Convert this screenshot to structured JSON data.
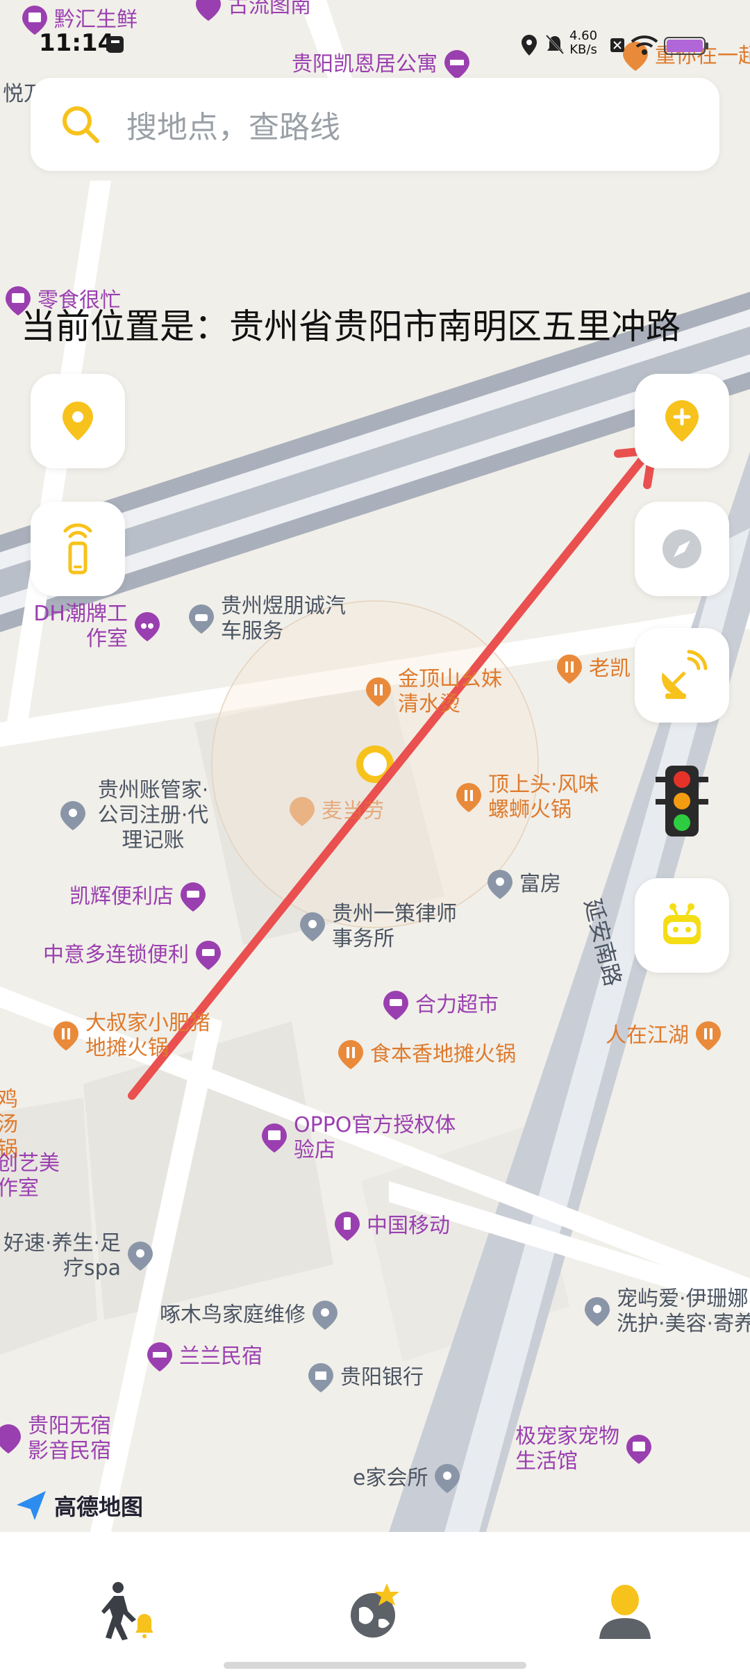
{
  "status_bar": {
    "time": "11:14",
    "net_speed": "4.60",
    "net_unit": "KB/s"
  },
  "search": {
    "placeholder": "搜地点，查路线"
  },
  "location": {
    "text": "当前位置是：贵州省贵阳市南明区五里冲路"
  },
  "brand": {
    "name": "高德地图"
  },
  "road_label": {
    "text": "延安南路"
  },
  "pois": [
    {
      "name": "黔汇生鲜",
      "color": "purple"
    },
    {
      "name": "古流图南",
      "color": "purple"
    },
    {
      "name": "贵阳凯恩居公寓",
      "color": "purple"
    },
    {
      "name": "重你在一起",
      "color": "orange"
    },
    {
      "name": "悦万",
      "color": "gray"
    },
    {
      "name": "零食很忙",
      "color": "purple"
    },
    {
      "name": "DH潮牌工作室",
      "color": "purple"
    },
    {
      "name": "贵州煜朋诚汽车服务",
      "color": "gray"
    },
    {
      "name": "金顶山幺妹清水烫",
      "color": "orange"
    },
    {
      "name": "老凯",
      "color": "orange"
    },
    {
      "name": "贵州账管家·公司注册·代理记账",
      "color": "gray"
    },
    {
      "name": "麦当劳",
      "color": "orange"
    },
    {
      "name": "顶上头·风味螺蛳火锅",
      "color": "orange"
    },
    {
      "name": "富房",
      "color": "gray"
    },
    {
      "name": "凯辉便利店",
      "color": "purple"
    },
    {
      "name": "贵州一策律师事务所",
      "color": "gray"
    },
    {
      "name": "中意多连锁便利",
      "color": "purple"
    },
    {
      "name": "合力超市",
      "color": "purple"
    },
    {
      "name": "大叔家小肥猪地摊火锅",
      "color": "orange"
    },
    {
      "name": "食本香地摊火锅",
      "color": "orange"
    },
    {
      "name": "人在江湖",
      "color": "orange"
    },
    {
      "name": "鸡汤锅",
      "color": "orange"
    },
    {
      "name": "OPPO官方授权体验店",
      "color": "purple"
    },
    {
      "name": "创艺美作室",
      "color": "purple"
    },
    {
      "name": "中国移动",
      "color": "purple"
    },
    {
      "name": "好速·养生·足疗spa",
      "color": "gray"
    },
    {
      "name": "啄木鸟家庭维修",
      "color": "gray"
    },
    {
      "name": "宠屿爱·伊珊娜洗护·美容·寄养",
      "color": "gray"
    },
    {
      "name": "兰兰民宿",
      "color": "purple"
    },
    {
      "name": "贵阳银行",
      "color": "gray"
    },
    {
      "name": "贵阳无宿影音民宿",
      "color": "purple"
    },
    {
      "name": "极宠家宠物生活馆",
      "color": "purple"
    },
    {
      "name": "e家会所",
      "color": "gray"
    }
  ],
  "side_buttons": {
    "left": [
      "location-pin",
      "phone-signal"
    ],
    "right": [
      "add-pin",
      "compass",
      "satellite-dish",
      "traffic-light",
      "robot"
    ]
  },
  "bottom_nav": [
    "walker-alert",
    "star-globe",
    "profile"
  ],
  "colors": {
    "accent": "#f7c21b",
    "purple": "#9a3fb0",
    "orange": "#de7a2d",
    "annotation": "#e9504f"
  }
}
